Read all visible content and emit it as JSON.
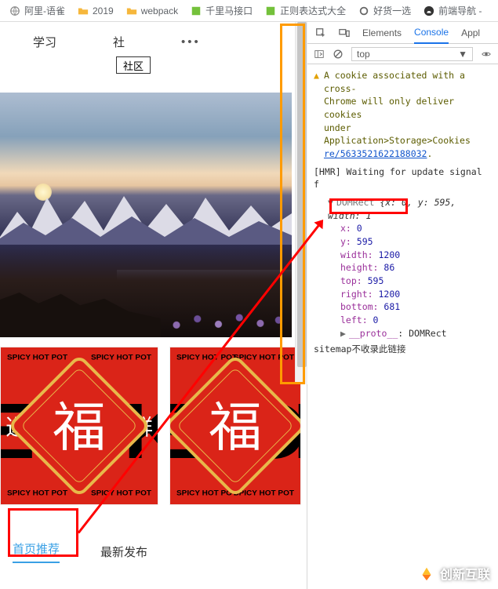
{
  "bookmarks": [
    {
      "label": "阿里-语雀"
    },
    {
      "label": "2019"
    },
    {
      "label": "webpack"
    },
    {
      "label": "千里马接口"
    },
    {
      "label": "正则表达式大全"
    },
    {
      "label": "好货一选"
    },
    {
      "label": "前端导航 - "
    }
  ],
  "topnav": {
    "item1": "学习",
    "item2": "社",
    "more": "•••",
    "shequ": "社区"
  },
  "cards": {
    "spicy": "SPICY HOT POT",
    "brush": "ECOK",
    "main": "福",
    "left_ch": "选",
    "right_ch": "鲜"
  },
  "tabs": {
    "active": "首页推荐",
    "inactive": "最新发布"
  },
  "devtools": {
    "tabs": {
      "elements": "Elements",
      "console": "Console",
      "appl": "Appl"
    },
    "ctx": {
      "top": "top",
      "eye_title": "Live expressions",
      "filter": ""
    },
    "warn": {
      "l1": "A cookie associated with a cross-",
      "l2": "Chrome will only deliver cookies ",
      "l3": "under Application>Storage>Cookies",
      "link": "re/5633521622188032",
      "dot": "."
    },
    "hmr": "[HMR] Waiting for update signal f",
    "obj": {
      "head": "DOMRect {x: 0, y: 595, width: 1",
      "x": "x: ",
      "xv": "0",
      "y": "y: ",
      "yv": "595",
      "w": "width: ",
      "wv": "1200",
      "h": "height: ",
      "hv": "86",
      "t": "top: ",
      "tv": "595",
      "r": "right: ",
      "rv": "1200",
      "b": "bottom: ",
      "bv": "681",
      "l": "left: ",
      "lv": "0",
      "proto": "__proto__",
      "protov": ": DOMRect"
    },
    "sitemap": "sitemap不收录此链接"
  },
  "watermark": "创新互联"
}
